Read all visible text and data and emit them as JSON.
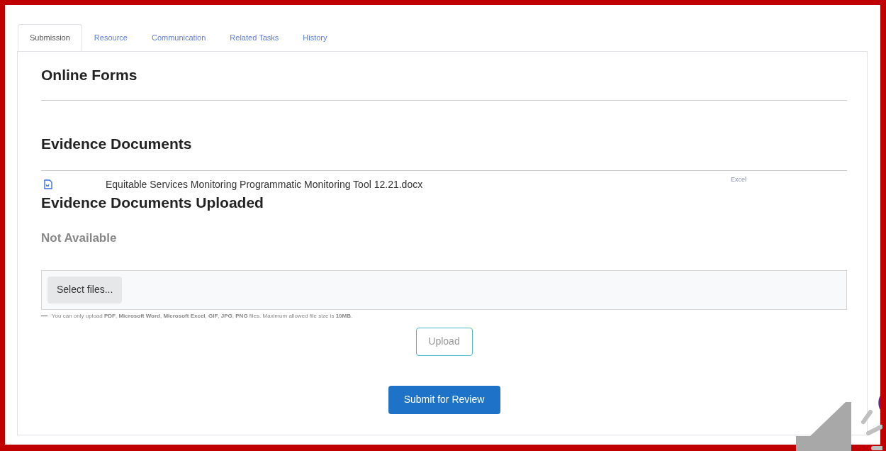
{
  "tabs": [
    {
      "label": "Submission",
      "selected": true
    },
    {
      "label": "Resource",
      "selected": false
    },
    {
      "label": "Communication",
      "selected": false
    },
    {
      "label": "Related Tasks",
      "selected": false
    },
    {
      "label": "History",
      "selected": false
    }
  ],
  "online_forms": {
    "title": "Online Forms"
  },
  "evidence_documents": {
    "title": "Evidence Documents",
    "files": [
      {
        "name": "Equitable Services Monitoring Programmatic Monitoring Tool 12.21.docx",
        "type": "Excel"
      }
    ]
  },
  "uploaded": {
    "title": "Evidence Documents Uploaded",
    "status": "Not Available"
  },
  "upload": {
    "select_button": "Select files...",
    "hint": "You can only upload **PDF**, **Microsoft Word**, **Microsoft Excel**, **GIF**, **JPG**, **PNG** files. Maximum allowed file size is **10MB**.",
    "upload_button": "Upload"
  },
  "submit_button": "Submit for Review"
}
